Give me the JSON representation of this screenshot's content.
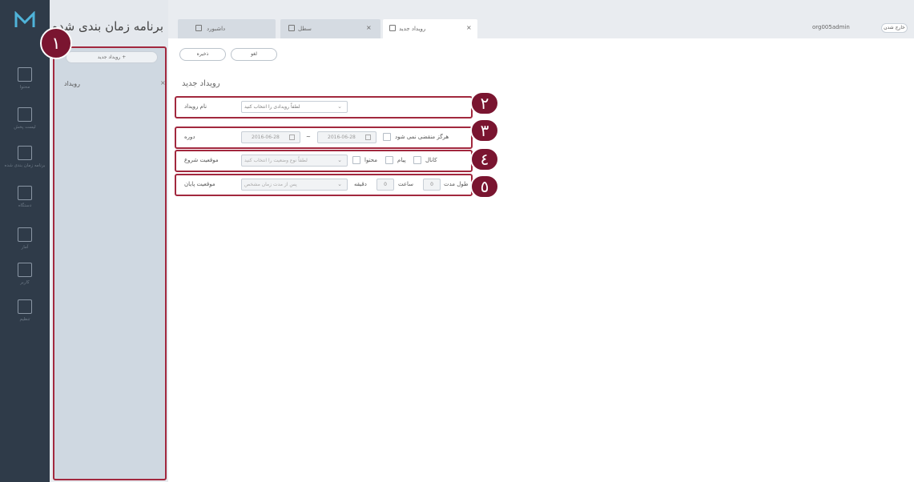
{
  "app": {
    "title": "برنامه زمان بندی شده",
    "logo": "M"
  },
  "rail": {
    "items": [
      {
        "icon": "grid-icon",
        "label": "محتوا"
      },
      {
        "icon": "playlist-icon",
        "label": "لیست پخش"
      },
      {
        "icon": "calendar-icon",
        "label": "برنامه زمان بندی شده"
      },
      {
        "icon": "monitor-icon",
        "label": "دستگاه"
      },
      {
        "icon": "chart-icon",
        "label": "آمار"
      },
      {
        "icon": "user-icon",
        "label": "کاربر"
      },
      {
        "icon": "settings-icon",
        "label": "تنظیم"
      }
    ]
  },
  "sidebar": {
    "new_event": "رویداد جدید",
    "items": [
      {
        "label": "رویداد",
        "close": "×"
      }
    ]
  },
  "tabs": [
    {
      "label": "داشبورد",
      "closable": false,
      "active": false
    },
    {
      "label": "سطل",
      "close": "×",
      "active": false
    },
    {
      "label": "رویداد جدید",
      "close": "×",
      "active": true
    }
  ],
  "header": {
    "user": "org005admin",
    "logout": "خارج شدن"
  },
  "toolbar": {
    "cancel": "لغو",
    "save": "ذخیره"
  },
  "form": {
    "title": "رویداد جدید",
    "event_name": {
      "label": "نام رویداد",
      "placeholder": "لطفاً رویدادی را انتخاب کنید"
    },
    "period": {
      "label": "دوره",
      "start": "2016-06-28",
      "end": "2016-06-28",
      "separator": "~",
      "never_expire": "هرگز منقضی نمی شود"
    },
    "start_position": {
      "label": "موقعیت شروع",
      "placeholder": "لطفاً نوع وضعیت را انتخاب کنید",
      "options": [
        "محتوا",
        "پیام",
        "کانال"
      ]
    },
    "end_position": {
      "label": "موقعیت پایان",
      "placeholder": "پس از مدت زمان مشخص",
      "duration_label": "طول مدت",
      "hours": "0",
      "hours_unit": "ساعت",
      "minutes": "0",
      "minutes_unit": "دقیقه"
    }
  },
  "callouts": [
    "١",
    "٢",
    "٣",
    "٤",
    "٥"
  ],
  "colors": {
    "accent": "#a2283e",
    "badge": "#7a1530",
    "rail": "#2f3b49",
    "sidebar": "#cfd8e1"
  }
}
